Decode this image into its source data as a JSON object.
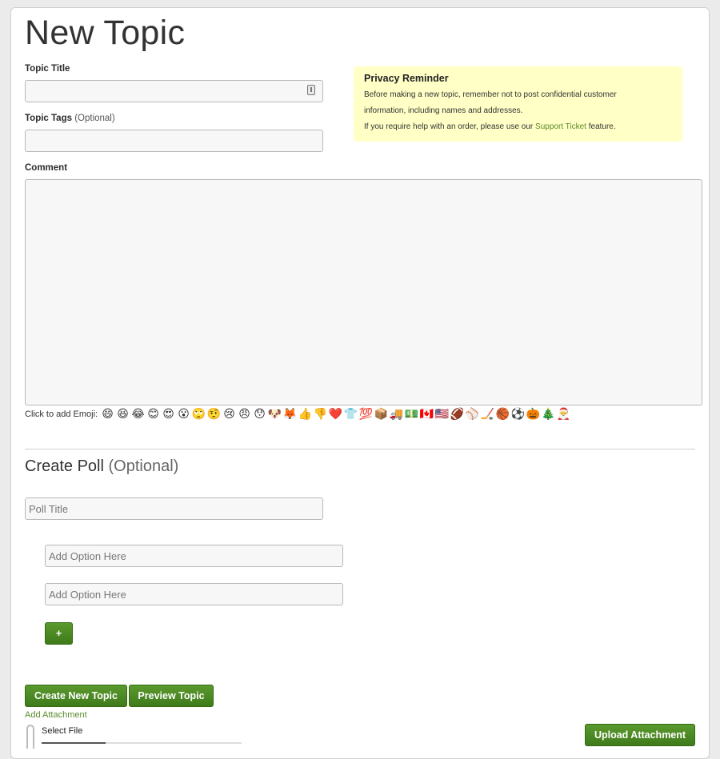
{
  "page": {
    "title": "New Topic"
  },
  "form": {
    "topic_title_label": "Topic Title",
    "topic_title_value": "",
    "topic_tags_label": "Topic Tags",
    "topic_tags_optional": "(Optional)",
    "topic_tags_value": "",
    "comment_label": "Comment",
    "comment_value": ""
  },
  "privacy": {
    "title": "Privacy Reminder",
    "line1": "Before making a new topic, remember not to post confidential customer",
    "line2": "information, including names and addresses.",
    "line3_before": "If you require help with an order, please use our ",
    "line3_link": "Support Ticket",
    "line3_after": " feature."
  },
  "emoji": {
    "label": "Click to add Emoji:",
    "items": [
      "😄",
      "😆",
      "😂",
      "😊",
      "😍",
      "😮",
      "🙄",
      "🤨",
      "😢",
      "😠",
      "😯",
      "🐶",
      "🦊",
      "👍",
      "👎",
      "❤️",
      "👕",
      "💯",
      "📦",
      "🚚",
      "💵",
      "🇨🇦",
      "🇺🇸",
      "🏈",
      "⚾",
      "🏒",
      "🏀",
      "⚽",
      "🎃",
      "🎄",
      "🎅"
    ]
  },
  "poll": {
    "heading": "Create Poll",
    "heading_optional": "(Optional)",
    "title_placeholder": "Poll Title",
    "option1_placeholder": "Add Option Here",
    "option2_placeholder": "Add Option Here",
    "add_option_label": "+"
  },
  "actions": {
    "create_label": "Create New Topic",
    "preview_label": "Preview Topic",
    "add_attachment_label": "Add Attachment",
    "select_file_label": "Select File",
    "upload_label": "Upload Attachment"
  },
  "colors": {
    "accent_green": "#4a8a22",
    "link_green": "#5a8a2a",
    "privacy_bg": "#ffffc6"
  }
}
